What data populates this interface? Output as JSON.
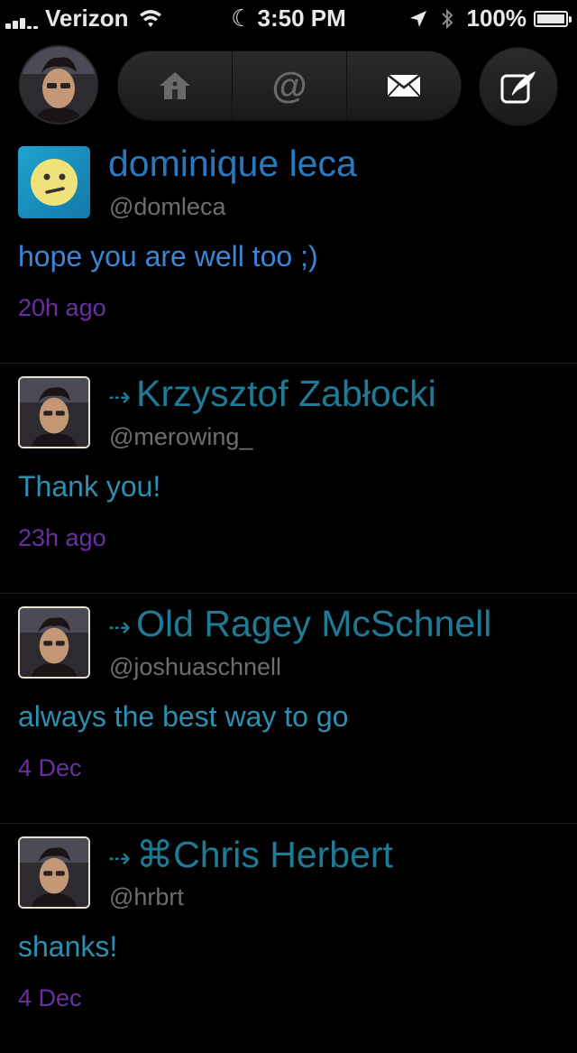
{
  "status_bar": {
    "carrier": "Verizon",
    "time": "3:50 PM",
    "battery": "100%",
    "battery_level": 1.0
  },
  "toolbar": {
    "tabs": [
      {
        "icon": "home-icon",
        "selected": false
      },
      {
        "icon": "mention-icon",
        "selected": false
      },
      {
        "icon": "mail-icon",
        "selected": true
      }
    ],
    "compose_icon": "compose-icon"
  },
  "tweets": [
    {
      "name": "dominique leca",
      "handle": "@domleca",
      "text": "hope you are well too ;)",
      "time": "20h ago",
      "reply": false
    },
    {
      "name": "Krzysztof Zabłocki",
      "handle": "@merowing_",
      "text": "Thank you!",
      "time": "23h ago",
      "reply": true
    },
    {
      "name": "Old Ragey McSchnell",
      "handle": "@joshuaschnell",
      "text": "always the best way to go",
      "time": "4 Dec",
      "reply": true
    },
    {
      "name": "⌘Chris Herbert",
      "handle": "@hrbrt",
      "text": "shanks!",
      "time": "4 Dec",
      "reply": true
    }
  ],
  "colors": {
    "name": "#2a78c0",
    "reply_name": "#1f7a95",
    "handle": "#6e6e6e",
    "time": "#6a2fa0",
    "background": "#000000"
  }
}
